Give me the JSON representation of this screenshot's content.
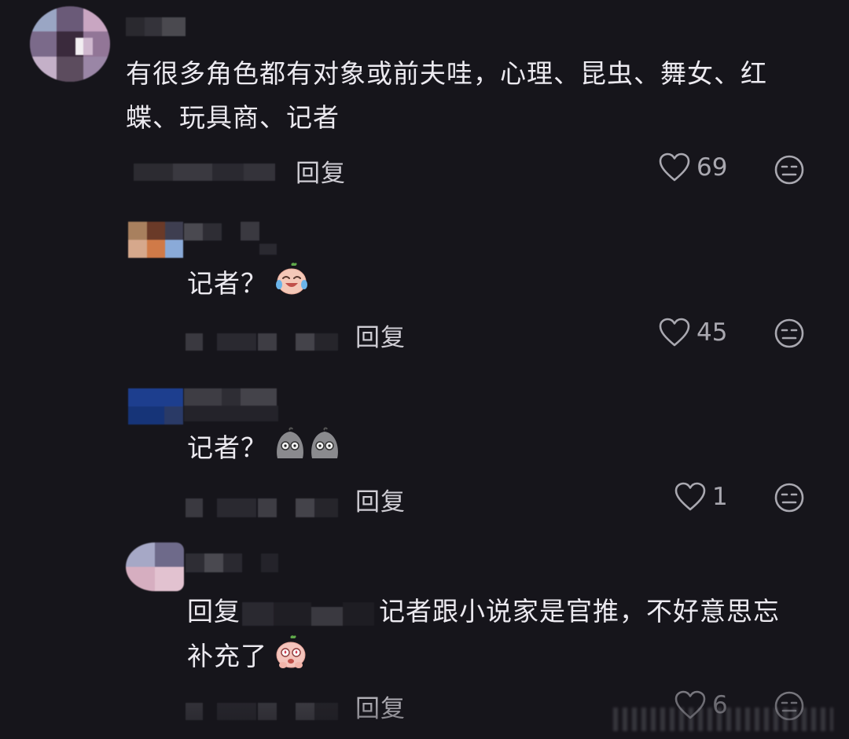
{
  "comments": [
    {
      "text_line1": "有很多角色都有对象或前夫哇，心理、昆虫、舞女、红",
      "text_line2": "蝶、玩具商、记者",
      "reply_label": "回复",
      "likes": "69"
    },
    {
      "text": "记者？",
      "emoji_icon": "crying-laughing-peach-icon",
      "reply_label": "回复",
      "likes": "45"
    },
    {
      "text": "记者？",
      "emoji_icon": "shocked-gray-face-icon",
      "reply_label": "回复",
      "likes": "1"
    },
    {
      "reply_prefix": "回复",
      "text_line1": "记者跟小说家是官推，不好意思忘",
      "text_line2": "补充了",
      "emoji_icon": "pleading-peach-icon",
      "reply_label": "回复",
      "likes": "6"
    }
  ],
  "colors": {
    "background": "#16151b",
    "text": "#eceaf0",
    "meta": "#a9a8b0"
  }
}
